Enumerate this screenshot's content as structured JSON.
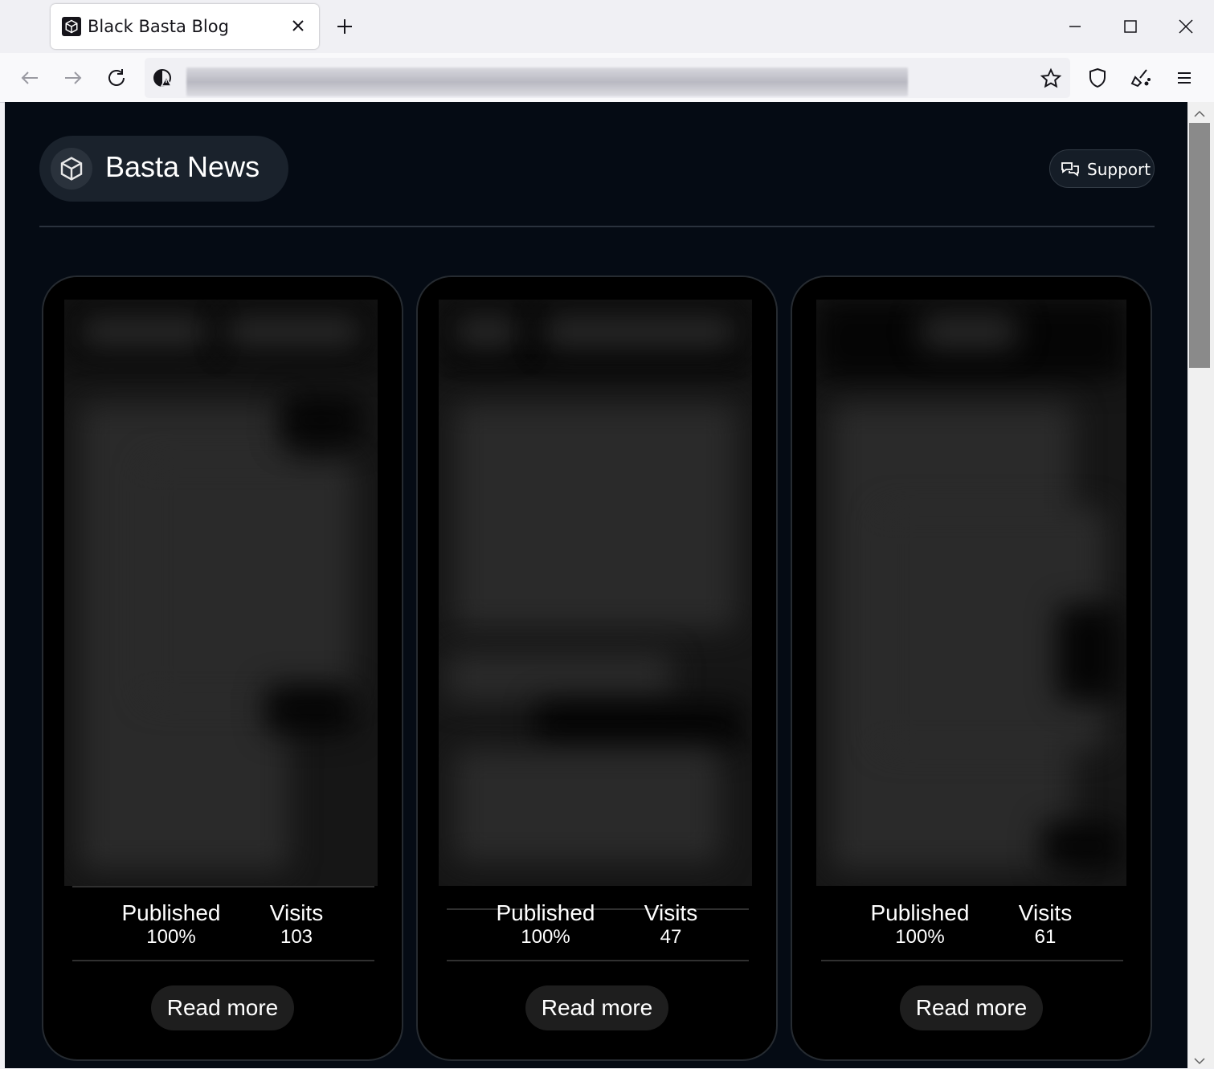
{
  "browser": {
    "tab_title": "Black Basta Blog",
    "url": ""
  },
  "header": {
    "brand_title": "Basta News",
    "support_label": "Support"
  },
  "cards": [
    {
      "published_label": "Published",
      "published_value": "100%",
      "visits_label": "Visits",
      "visits_value": "103",
      "button_label": "Read more"
    },
    {
      "published_label": "Published",
      "published_value": "100%",
      "visits_label": "Visits",
      "visits_value": "47",
      "button_label": "Read more"
    },
    {
      "published_label": "Published",
      "published_value": "100%",
      "visits_label": "Visits",
      "visits_value": "61",
      "button_label": "Read more"
    }
  ],
  "colors": {
    "page_background": "#050b14",
    "card_background": "#000000",
    "button_background": "#1e1e1e"
  }
}
